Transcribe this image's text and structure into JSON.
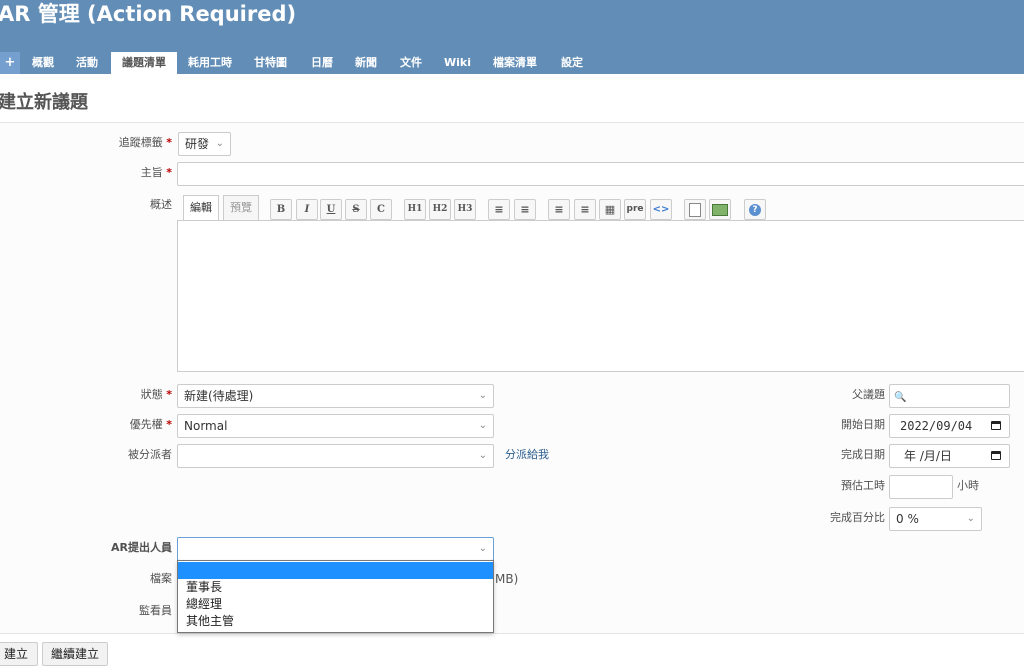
{
  "header": {
    "title": "AR 管理 (Action Required)"
  },
  "menu": {
    "new": "+",
    "items": [
      "概觀",
      "活動",
      "議題清單",
      "耗用工時",
      "甘特圖",
      "日曆",
      "新聞",
      "文件",
      "Wiki",
      "檔案清單",
      "設定"
    ]
  },
  "page": {
    "title": "建立新議題"
  },
  "form": {
    "tracker": {
      "label": "追蹤標籤",
      "value": "研發"
    },
    "subject": {
      "label": "主旨",
      "value": ""
    },
    "description": {
      "label": "概述",
      "tab_edit": "編輯",
      "tab_preview": "預覽",
      "toolbar": {
        "bold": "B",
        "italic": "I",
        "underline": "U",
        "strike": "S",
        "code": "C",
        "h1": "H1",
        "h2": "H2",
        "h3": "H3",
        "pre": "pre"
      }
    },
    "status": {
      "label": "狀態",
      "value": "新建(待處理)"
    },
    "priority": {
      "label": "優先權",
      "value": "Normal"
    },
    "assignee": {
      "label": "被分派者",
      "value": "",
      "assign_to_me": "分派給我"
    },
    "parent": {
      "label": "父議題",
      "value": ""
    },
    "start_date": {
      "label": "開始日期",
      "value": "2022/09/04"
    },
    "due_date": {
      "label": "完成日期",
      "value": "年 /月/日"
    },
    "estimated": {
      "label": "預估工時",
      "value": "",
      "unit": "小時"
    },
    "done_ratio": {
      "label": "完成百分比",
      "value": "0 %"
    },
    "ar_requester": {
      "label": "AR提出人員",
      "value": "",
      "options": [
        "",
        "董事長",
        "總經理",
        "其他主管"
      ]
    },
    "files": {
      "label": "檔案",
      "max_size_fragment": "MB)"
    },
    "watchers": {
      "label": "監看員"
    },
    "required_mark": "*"
  },
  "buttons": {
    "create": "建立",
    "create_continue": "繼續建立"
  },
  "colors": {
    "header_bg": "#628db6",
    "menu_new_bg": "#759fcf",
    "highlight": "#1e90ff",
    "required": "#bb0000",
    "link": "#2a5d8e"
  }
}
